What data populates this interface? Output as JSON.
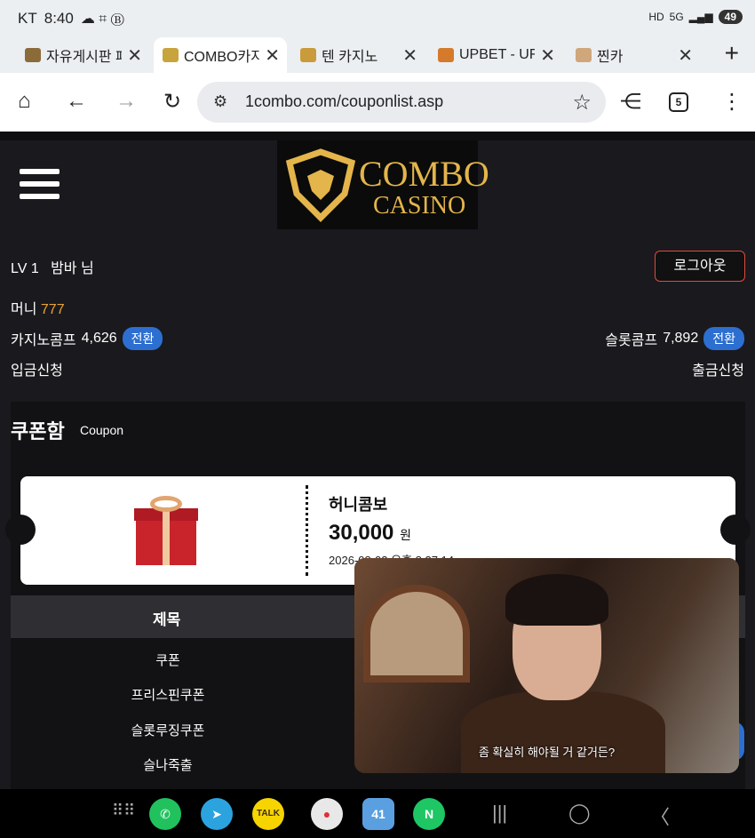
{
  "status": {
    "carrier": "KT",
    "time": "8:40",
    "battery": "49",
    "signal": "5G"
  },
  "tabs": [
    {
      "title": "자유게시판 페",
      "fav_color": "#8b6b3a",
      "active": false
    },
    {
      "title": "COMBO카지",
      "fav_color": "#c8a43c",
      "active": true
    },
    {
      "title": "텐 카지노",
      "fav_color": "#c99b3b",
      "active": false
    },
    {
      "title": "UPBET - UF",
      "fav_color": "#d47a2a",
      "active": false
    },
    {
      "title": "찐카",
      "fav_color": "#cfa77a",
      "active": false
    }
  ],
  "toolbar": {
    "url": "1combo.com/couponlist.asp",
    "tab_count": "5"
  },
  "logo": {
    "line1": "COMBO",
    "line2": "CASINO"
  },
  "user": {
    "level": "LV 1",
    "name": "밤바 님",
    "logout_label": "로그아웃"
  },
  "money": {
    "label": "머니",
    "value": "777"
  },
  "comp": {
    "casino_label": "카지노콤프",
    "casino_value": "4,626",
    "slot_label": "슬롯콤프",
    "slot_value": "7,892",
    "convert_label": "전환"
  },
  "links": {
    "deposit": "입금신청",
    "withdraw": "출금신청"
  },
  "coupon": {
    "title": "쿠폰함",
    "subtitle": "Coupon",
    "name": "허니콤보",
    "amount": "30,000",
    "unit": "원",
    "date": "2026-08-02 오후 8:37:14"
  },
  "table": {
    "header": "제목",
    "rows": [
      "쿠폰",
      "프리스핀쿠폰",
      "슬롯루징쿠폰",
      "슬나죽출"
    ]
  },
  "video": {
    "caption": "좀 확실히 해야될 거 같거든?"
  },
  "dock": [
    {
      "name": "phone",
      "label": "✆",
      "color": "#21c25e"
    },
    {
      "name": "telegram",
      "label": "➤",
      "color": "#2aa3de"
    },
    {
      "name": "kakaotalk",
      "label": "TALK",
      "color": "#f6d400"
    },
    {
      "name": "chrome",
      "label": "●",
      "color": "#e8e8e8"
    },
    {
      "name": "game",
      "label": "41",
      "color": "#5aa0e0"
    },
    {
      "name": "naver",
      "label": "N",
      "color": "#1ec763"
    }
  ]
}
